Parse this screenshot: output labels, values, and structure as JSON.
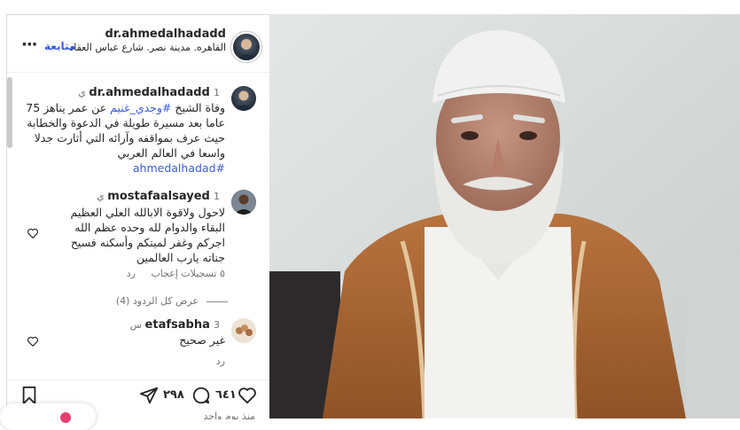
{
  "header": {
    "username": "dr.ahmedalhadadd",
    "location": "القاهره. مدينة نصر. شارع عباس العقاد",
    "follow_label": "متابعة",
    "more_glyph": "···"
  },
  "caption": {
    "username": "dr.ahmedalhadadd",
    "time": "1 ي",
    "text_prefix": "وفاة الشيخ ",
    "mention": "#وجدي_غنيم",
    "text_body": " عن عمر يناهز 75 عاما بعد مسيرة طويلة في الدعوة والخطابة حيث عرف بمواقفه وآرائه التي أثارت جدلا واسعا في العالم العربي",
    "hashtag": "#ahmedalhadad"
  },
  "comments": [
    {
      "username": "mostafaalsayed",
      "time": "1 ي",
      "text": "لاحول ولاقوة الابالله العلي العظيم البقاء والدوام لله وحده عظم الله اجركم وغفر لميتكم وأسكنه فسيح جناته يارب العالمين",
      "likes": "٥ تسجيلات إعجاب",
      "reply_label": "رد"
    },
    {
      "username": "etafsabha",
      "time": "3 س",
      "text": "غير صحيح",
      "reply_label": "رد"
    }
  ],
  "view_replies": "عرض كل الردود (4)",
  "actions": {
    "likes_count": "٦٤١",
    "comments_count": "٢٩٨"
  },
  "footer": {
    "posted_time": "منذ يوم واحد"
  },
  "icons": {
    "like": "heart-icon",
    "comment": "comment-icon",
    "share": "share-icon",
    "save": "bookmark-icon",
    "comment_like": "heart-outline-icon"
  },
  "colors": {
    "hashtag": "#3b5bdb",
    "link": "#00376b",
    "robe": "#b06a37",
    "cap": "#f1f1f1"
  }
}
